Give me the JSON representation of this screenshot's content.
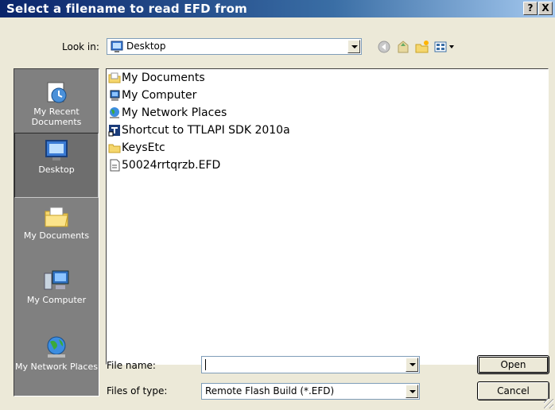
{
  "window": {
    "title": "Select a filename to read EFD from",
    "help_label": "?",
    "close_label": "X"
  },
  "lookin": {
    "label": "Look in:",
    "value": "Desktop"
  },
  "toolbar": {
    "icons": [
      "back-icon",
      "up-folder-icon",
      "new-folder-icon",
      "views-icon"
    ]
  },
  "places": [
    {
      "label": "My Recent Documents",
      "icon": "recent-documents-icon"
    },
    {
      "label": "Desktop",
      "icon": "desktop-icon",
      "selected": true
    },
    {
      "label": "My Documents",
      "icon": "my-documents-icon"
    },
    {
      "label": "My Computer",
      "icon": "my-computer-icon"
    },
    {
      "label": "My Network Places",
      "icon": "network-places-icon"
    }
  ],
  "files": [
    {
      "name": "My Documents",
      "icon": "folder-documents-icon"
    },
    {
      "name": "My Computer",
      "icon": "computer-icon"
    },
    {
      "name": "My Network Places",
      "icon": "network-icon"
    },
    {
      "name": "Shortcut to TTLAPI SDK 2010a",
      "icon": "shortcut-icon"
    },
    {
      "name": "KeysEtc",
      "icon": "folder-icon"
    },
    {
      "name": "50024rrtqrzb.EFD",
      "icon": "file-icon"
    }
  ],
  "filename": {
    "label": "File name:",
    "value": ""
  },
  "filetype": {
    "label": "Files of type:",
    "value": "Remote Flash Build (*.EFD)"
  },
  "buttons": {
    "open": "Open",
    "cancel": "Cancel"
  }
}
